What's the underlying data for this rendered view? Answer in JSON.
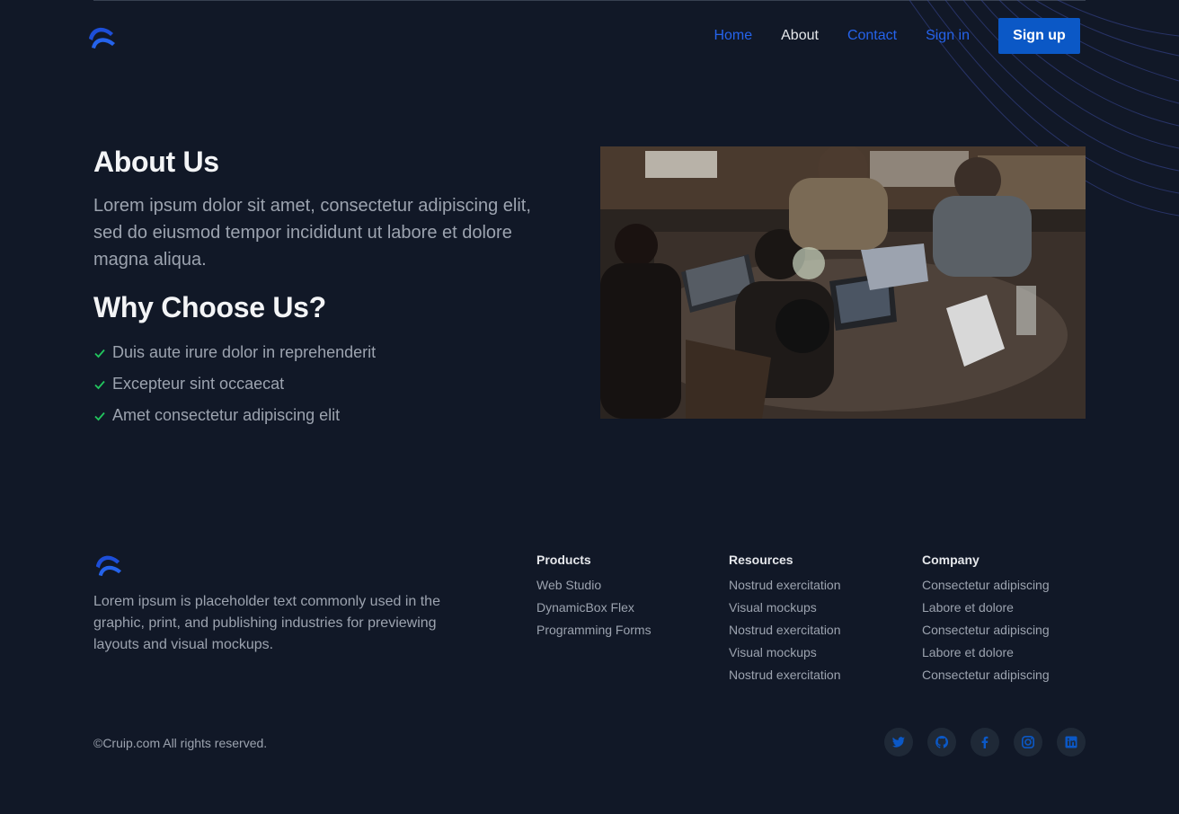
{
  "header": {
    "nav": [
      {
        "label": "Home"
      },
      {
        "label": "About"
      },
      {
        "label": "Contact"
      },
      {
        "label": "Sign in"
      }
    ],
    "signup_label": "Sign up"
  },
  "hero": {
    "title": "About Us",
    "paragraph": "Lorem ipsum dolor sit amet, consectetur adipiscing elit, sed do eiusmod tempor incididunt ut labore et dolore magna aliqua.",
    "why_title": "Why Choose Us?",
    "features": [
      "Duis aute irure dolor in reprehenderit",
      "Excepteur sint occaecat",
      "Amet consectetur adipiscing elit"
    ]
  },
  "footer": {
    "description": "Lorem ipsum is placeholder text commonly used in the graphic, print, and publishing industries for previewing layouts and visual mockups.",
    "columns": [
      {
        "title": "Products",
        "links": [
          "Web Studio",
          "DynamicBox Flex",
          "Programming Forms"
        ]
      },
      {
        "title": "Resources",
        "links": [
          "Nostrud exercitation",
          "Visual mockups",
          "Nostrud exercitation",
          "Visual mockups",
          "Nostrud exercitation"
        ]
      },
      {
        "title": "Company",
        "links": [
          "Consectetur adipiscing",
          "Labore et dolore",
          "Consectetur adipiscing",
          "Labore et dolore",
          "Consectetur adipiscing"
        ]
      }
    ],
    "copyright": "©Cruip.com All rights reserved.",
    "socials": [
      "twitter-icon",
      "github-icon",
      "facebook-icon",
      "instagram-icon",
      "linkedin-icon"
    ]
  },
  "colors": {
    "background": "#111827",
    "accent": "#0b58c6",
    "link": "#2563eb",
    "check": "#22c55e"
  }
}
